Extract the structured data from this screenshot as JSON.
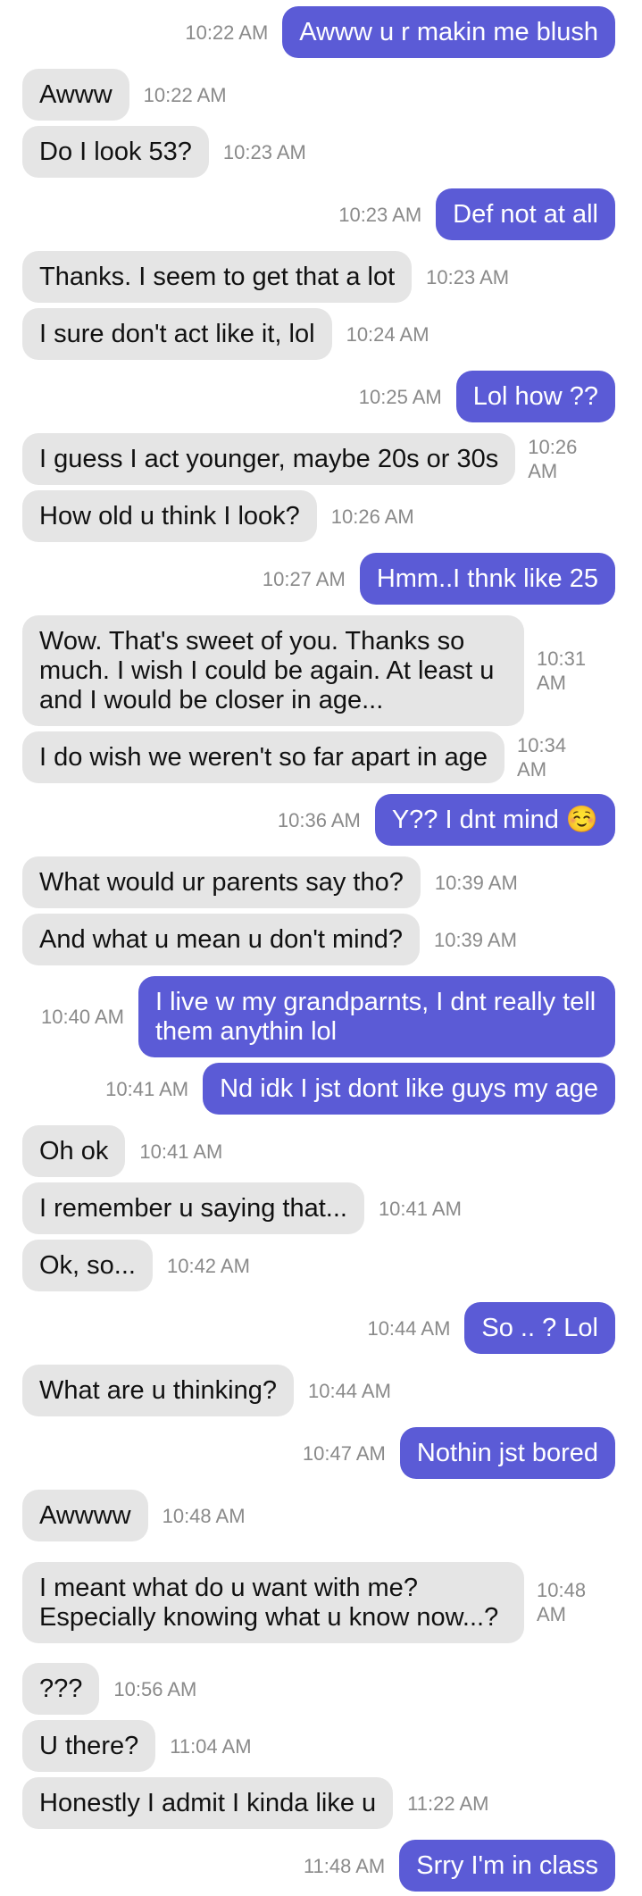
{
  "messages": [
    {
      "text": "Awww u r makin me blush",
      "time": "10:22 AM"
    },
    {
      "text": "Awww",
      "time": "10:22 AM"
    },
    {
      "text": "Do I look 53?",
      "time": "10:23 AM"
    },
    {
      "text": "Def not at all",
      "time": "10:23 AM"
    },
    {
      "text": "Thanks. I seem to get that a lot",
      "time": "10:23 AM"
    },
    {
      "text": "I sure don't act like it, lol",
      "time": "10:24 AM"
    },
    {
      "text": "Lol how ??",
      "time": "10:25 AM"
    },
    {
      "text": "I guess I act younger, maybe 20s or 30s",
      "time": "10:26 AM"
    },
    {
      "text": "How old u think I look?",
      "time": "10:26 AM"
    },
    {
      "text": "Hmm..I thnk like 25",
      "time": "10:27 AM"
    },
    {
      "text": "Wow. That's sweet of you. Thanks so much. I wish I could be again. At least u and I would be closer in age...",
      "time": "10:31 AM"
    },
    {
      "text": "I do wish we weren't so far apart in age",
      "time": "10:34 AM"
    },
    {
      "text": "Y?? I dnt mind ☺️",
      "time": "10:36 AM"
    },
    {
      "text": "What would ur parents say tho?",
      "time": "10:39 AM"
    },
    {
      "text": "And what u mean u don't mind?",
      "time": "10:39 AM"
    },
    {
      "text": "I live w my grandparnts, I dnt really tell them anythin lol",
      "time": "10:40 AM"
    },
    {
      "text": "Nd idk I jst dont like guys my age",
      "time": "10:41 AM"
    },
    {
      "text": "Oh ok",
      "time": "10:41 AM"
    },
    {
      "text": "I remember u saying that...",
      "time": "10:41 AM"
    },
    {
      "text": "Ok, so...",
      "time": "10:42 AM"
    },
    {
      "text": "So .. ? Lol",
      "time": "10:44 AM"
    },
    {
      "text": "What are u thinking?",
      "time": "10:44 AM"
    },
    {
      "text": "Nothin jst bored",
      "time": "10:47 AM"
    },
    {
      "text": "Awwww",
      "time": "10:48 AM"
    },
    {
      "text": "I meant what do u want with me? Especially knowing what u know now...?",
      "time": "10:48 AM"
    },
    {
      "text": "???",
      "time": "10:56 AM"
    },
    {
      "text": "U there?",
      "time": "11:04 AM"
    },
    {
      "text": "Honestly I admit I kinda like u",
      "time": "11:22 AM"
    },
    {
      "text": "Srry I'm in class",
      "time": "11:48 AM"
    }
  ],
  "colors": {
    "sent_bubble": "#5b5bd6",
    "received_bubble": "#e5e5e5",
    "timestamp": "#8a8a8a"
  }
}
